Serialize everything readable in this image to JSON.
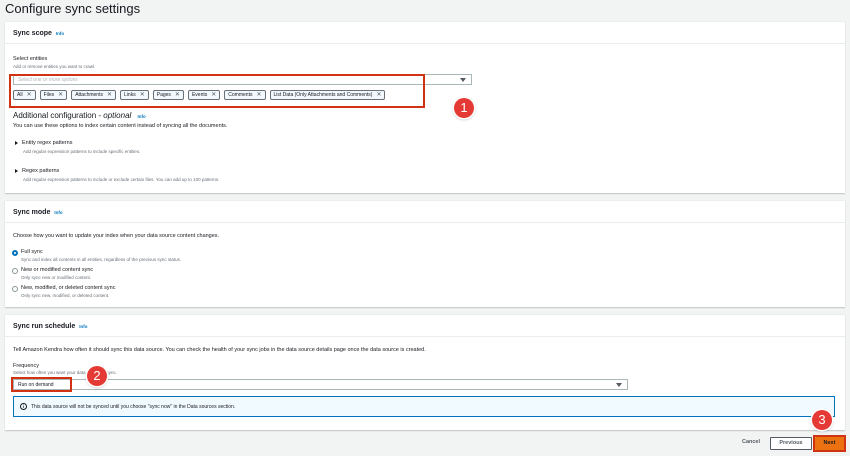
{
  "page": {
    "title": "Configure sync settings"
  },
  "sync_scope": {
    "title": "Sync scope",
    "info": "Info",
    "select_label": "Select entities",
    "select_desc": "Add or remove entities you want to crawl.",
    "placeholder": "Select one or more options",
    "tokens": [
      "All",
      "Files",
      "Attachments",
      "Links",
      "Pages",
      "Events",
      "Comments",
      "List Data (Only Attachments and Comments)"
    ],
    "additional_title": "Additional configuration - ",
    "additional_optional": "optional",
    "additional_info": "Info",
    "additional_desc": "You can use these options to index certain content instead of syncing all the documents.",
    "entity_regex_title": "Entity regex patterns",
    "entity_regex_desc": "Add regular expression patterns to include specific entities.",
    "regex_title": "Regex patterns",
    "regex_desc": "Add regular expression patterns to include or exclude certain files. You can add up to 100 patterns."
  },
  "sync_mode": {
    "title": "Sync mode",
    "info": "Info",
    "prompt": "Choose how you want to update your index when your data source content changes.",
    "options": [
      {
        "label": "Full sync",
        "desc": "Sync and index all contents in all entities, regardless of the previous sync status.",
        "checked": true
      },
      {
        "label": "New or modified content sync",
        "desc": "Only sync new or modified content.",
        "checked": false
      },
      {
        "label": "New, modified, or deleted content sync",
        "desc": "Only sync new, modified, or deleted content.",
        "checked": false
      }
    ]
  },
  "schedule": {
    "title": "Sync run schedule",
    "info": "Info",
    "desc": "Tell Amazon Kendra how often it should sync this data source. You can check the health of your sync jobs in the data source details page once the data source is created.",
    "freq_label": "Frequency",
    "freq_desc": "Select how often you want your data source to sync.",
    "freq_value": "Run on demand",
    "alert_icon": "i",
    "alert_text": "This data source will not be synced until you choose \"sync now\" in the Data sources section."
  },
  "footer": {
    "cancel": "Cancel",
    "previous": "Previous",
    "next": "Next"
  },
  "badges": [
    "1",
    "2",
    "3"
  ],
  "colors": {
    "accent": "#0073bb",
    "primary_button": "#ec7211",
    "annotation": "#e53935"
  }
}
